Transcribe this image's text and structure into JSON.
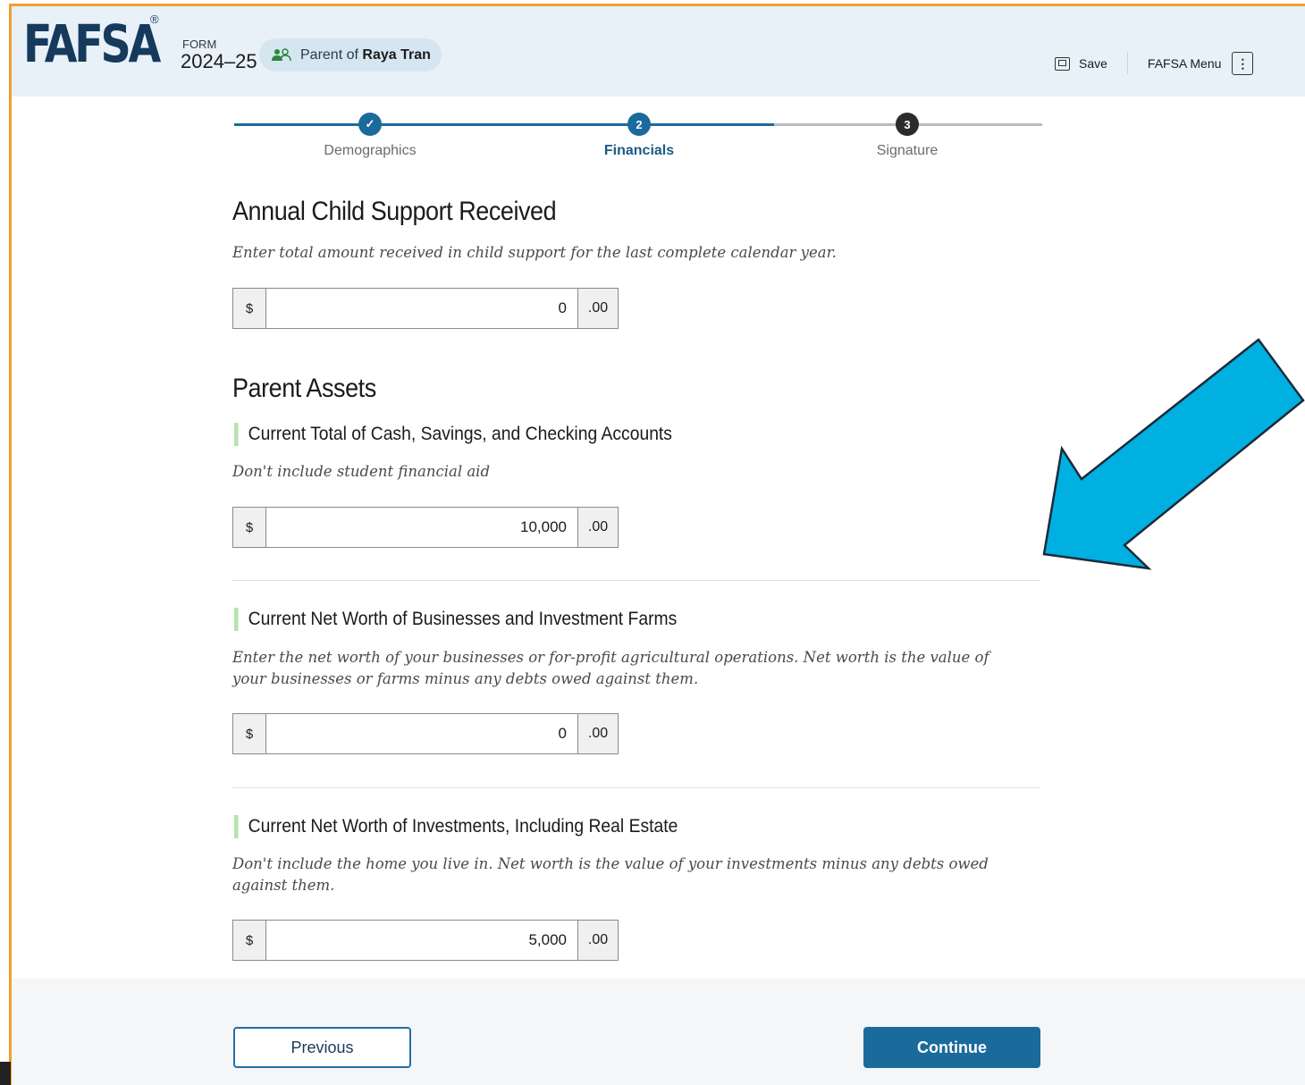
{
  "header": {
    "logo": "FAFSA",
    "registered": "®",
    "form_label": "FORM",
    "form_year": "2024–25",
    "role_prefix": "Parent of",
    "student_name": "Raya Tran",
    "save_label": "Save",
    "menu_label": "FAFSA Menu",
    "menu_glyph": "⋮"
  },
  "stepper": {
    "steps": [
      {
        "label": "Demographics",
        "marker": "✓",
        "state": "complete"
      },
      {
        "label": "Financials",
        "marker": "2",
        "state": "current"
      },
      {
        "label": "Signature",
        "marker": "3",
        "state": "upcoming"
      }
    ]
  },
  "child_support": {
    "heading": "Annual Child Support Received",
    "hint": "Enter total amount received in child support for the last complete calendar year.",
    "prefix": "$",
    "value": "0",
    "suffix": ".00"
  },
  "assets": {
    "heading": "Parent Assets",
    "cash": {
      "question": "Current Total of Cash, Savings, and Checking Accounts",
      "hint": "Don't include student financial aid",
      "prefix": "$",
      "value": "10,000",
      "suffix": ".00"
    },
    "business": {
      "question": "Current Net Worth of Businesses and Investment Farms",
      "hint": "Enter the net worth of your businesses or for-profit agricultural operations. Net worth is the value of your businesses or farms minus any debts owed against them.",
      "prefix": "$",
      "value": "0",
      "suffix": ".00"
    },
    "investments": {
      "question": "Current Net Worth of Investments, Including Real Estate",
      "hint": "Don't include the home you live in. Net worth is the value of your investments minus any debts owed against them.",
      "prefix": "$",
      "value": "5,000",
      "suffix": ".00"
    }
  },
  "footer": {
    "previous_label": "Previous",
    "continue_label": "Continue"
  },
  "colors": {
    "brand": "#163a5c",
    "primary": "#1a6a9c",
    "annotation_arrow": "#00b0e0",
    "frame": "#f0a030"
  }
}
